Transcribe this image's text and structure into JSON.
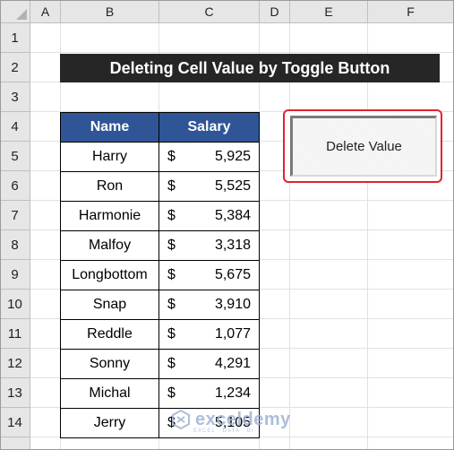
{
  "spreadsheet": {
    "columns": [
      "A",
      "B",
      "C",
      "D",
      "E",
      "F"
    ],
    "rows": [
      "1",
      "2",
      "3",
      "4",
      "5",
      "6",
      "7",
      "8",
      "9",
      "10",
      "11",
      "12",
      "13",
      "14"
    ]
  },
  "title": "Deleting Cell Value by Toggle Button",
  "table": {
    "headers": {
      "name": "Name",
      "salary": "Salary"
    },
    "currency": "$",
    "rows": [
      {
        "name": "Harry",
        "salary": "5,925"
      },
      {
        "name": "Ron",
        "salary": "5,525"
      },
      {
        "name": "Harmonie",
        "salary": "5,384"
      },
      {
        "name": "Malfoy",
        "salary": "3,318"
      },
      {
        "name": "Longbottom",
        "salary": "5,675"
      },
      {
        "name": "Snap",
        "salary": "3,910"
      },
      {
        "name": "Reddle",
        "salary": "1,077"
      },
      {
        "name": "Sonny",
        "salary": "4,291"
      },
      {
        "name": "Michal",
        "salary": "1,234"
      },
      {
        "name": "Jerry",
        "salary": "5,105"
      }
    ]
  },
  "toggle_button": {
    "label": "Delete Value"
  },
  "watermark": {
    "brand": "exceldemy",
    "tagline": "EXCEL · DATA · BI",
    "icon": "exceldemy-logo-icon"
  },
  "colors": {
    "header_fill": "#2f5597",
    "title_fill": "#262626",
    "highlight_border": "#e0242f"
  }
}
